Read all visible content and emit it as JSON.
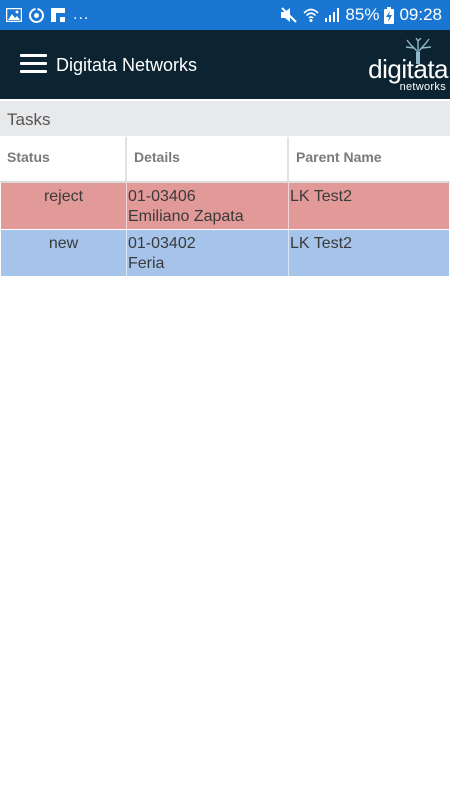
{
  "status_bar": {
    "battery": "85%",
    "time": "09:28",
    "more": "...",
    "icons": [
      "image-icon",
      "sync-icon",
      "flipboard-icon",
      "mute-icon",
      "wifi-icon",
      "signal-icon",
      "battery-charging-icon"
    ]
  },
  "app_bar": {
    "title": "Digitata Networks",
    "logo_text": "digitata",
    "logo_subtext": "networks"
  },
  "section": {
    "title": "Tasks"
  },
  "table": {
    "columns": [
      "Status",
      "Details",
      "Parent Name"
    ],
    "rows": [
      {
        "status": "reject",
        "details_line1": "01-03406",
        "details_line2": "Emiliano Zapata",
        "parent": "LK Test2",
        "color": "#e29a99"
      },
      {
        "status": "new",
        "details_line1": "01-03402",
        "details_line2": "Feria",
        "parent": "LK Test2",
        "color": "#a6c3ea"
      }
    ]
  },
  "colors": {
    "status_bar": "#1976d2",
    "app_bar": "#0c2431",
    "section_bg": "#e8e9eb"
  }
}
